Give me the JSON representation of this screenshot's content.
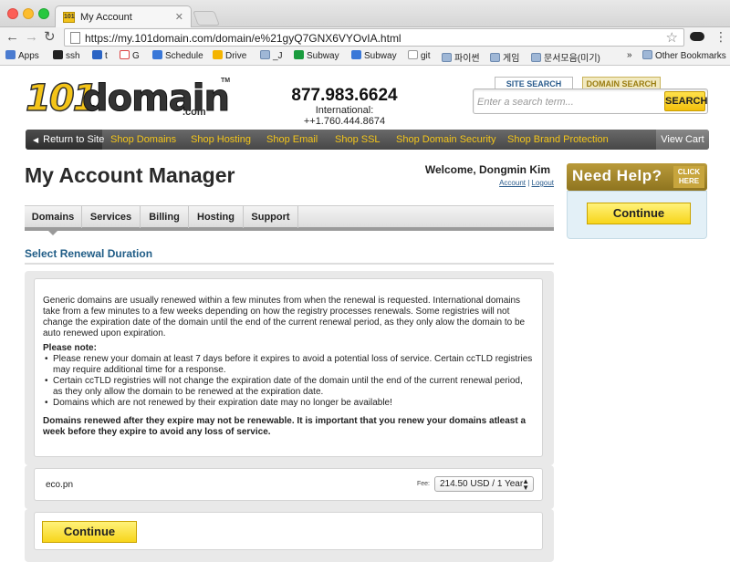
{
  "browser": {
    "tab_title": "My Account",
    "tab_favicon_text": "101",
    "url": "https://my.101domain.com/domain/e%21gyQ7GNX6VYOvIA.html",
    "bookmarks": [
      "Apps",
      "ssh",
      "t",
      "G",
      "Schedule",
      "Drive",
      "_J",
      "Subway",
      "Subway",
      "git",
      "파이썬",
      "게임",
      "문서모음(미기)",
      "»",
      "Other Bookmarks"
    ]
  },
  "header": {
    "logo_number": "101",
    "logo_word": "domain",
    "logo_suffix": ".com",
    "logo_tm": "TM",
    "phone": "877.983.6624",
    "international": "International: ++1.760.444.8674"
  },
  "search": {
    "tab_site": "SITE SEARCH",
    "tab_domain": "DOMAIN SEARCH",
    "placeholder": "Enter a search term...",
    "button": "SEARCH"
  },
  "main_nav": {
    "return": "Return to Site",
    "items": [
      "Shop Domains",
      "Shop Hosting",
      "Shop Email",
      "Shop SSL",
      "Shop Domain Security",
      "Shop Brand Protection"
    ],
    "cart": "View Cart"
  },
  "account": {
    "title": "My Account Manager",
    "welcome": "Welcome, Dongmin Kim",
    "link_account": "Account",
    "link_separator": " | ",
    "link_logout": "Logout",
    "tabs": [
      "Domains",
      "Services",
      "Billing",
      "Hosting",
      "Support"
    ]
  },
  "renewal": {
    "section_title": "Select Renewal Duration",
    "intro": "Generic domains are usually renewed within a few minutes from when the renewal is requested. International domains take from a few minutes to a few weeks depending on how the registry processes renewals. Some registries will not change the expiration date of the domain until the end of the current renewal period, as they only alow the domain to be auto renewed upon expiration.",
    "note_title": "Please note:",
    "notes": [
      "Please renew your domain at least 7 days before it expires to avoid a potential loss of service. Certain ccTLD registries may require additional time for a response.",
      "Certain ccTLD registries will not change the expiration date of the domain until the end of the current renewal period, as they only allow the domain to be renewed at the expiration date.",
      "Domains which are not renewed by their expiration date may no longer be available!"
    ],
    "warning": "Domains renewed after they expire may not be renewable. It is important that you renew your domains atleast a week before they expire to avoid any loss of service.",
    "domain": "eco.pn",
    "fee_label": "Fee:",
    "fee_selected": "214.50 USD / 1 Year",
    "continue": "Continue"
  },
  "help": {
    "title": "Need Help?",
    "click_here": "CLICK HERE",
    "continue": "Continue"
  }
}
